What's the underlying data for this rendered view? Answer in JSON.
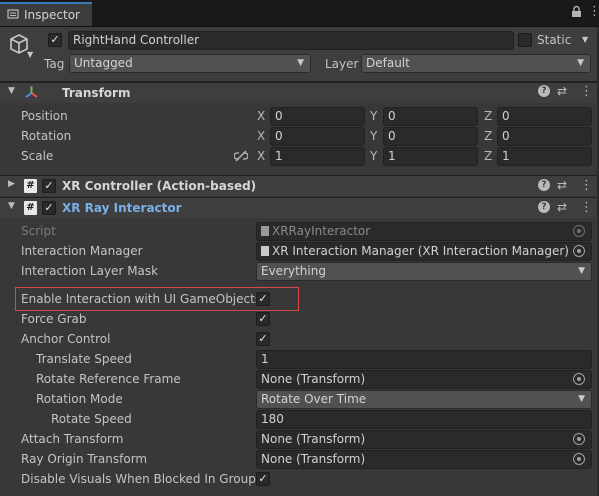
{
  "tab": {
    "label": "Inspector"
  },
  "header": {
    "object_name": "RightHand Controller",
    "static_label": "Static",
    "tag_label": "Tag",
    "tag_value": "Untagged",
    "layer_label": "Layer",
    "layer_value": "Default"
  },
  "transform": {
    "title": "Transform",
    "rows": [
      {
        "label": "Position",
        "x": "0",
        "y": "0",
        "z": "0"
      },
      {
        "label": "Rotation",
        "x": "0",
        "y": "0",
        "z": "0"
      },
      {
        "label": "Scale",
        "x": "1",
        "y": "1",
        "z": "1"
      }
    ],
    "axis": {
      "x": "X",
      "y": "Y",
      "z": "Z"
    }
  },
  "xr_controller": {
    "title": "XR Controller (Action-based)"
  },
  "xr_ray": {
    "title": "XR Ray Interactor",
    "script_label": "Script",
    "script_value": "XRRayInteractor",
    "interaction_manager_label": "Interaction Manager",
    "interaction_manager_value": "XR Interaction Manager (XR Interaction Manager)",
    "interaction_layer_mask_label": "Interaction Layer Mask",
    "interaction_layer_mask_value": "Everything",
    "enable_ui_label": "Enable Interaction with UI GameObjects",
    "force_grab_label": "Force Grab",
    "anchor_control_label": "Anchor Control",
    "translate_speed_label": "Translate Speed",
    "translate_speed_value": "1",
    "rotate_ref_label": "Rotate Reference Frame",
    "rotate_ref_value": "None (Transform)",
    "rotation_mode_label": "Rotation Mode",
    "rotation_mode_value": "Rotate Over Time",
    "rotate_speed_label": "Rotate Speed",
    "rotate_speed_value": "180",
    "attach_transform_label": "Attach Transform",
    "attach_transform_value": "None (Transform)",
    "ray_origin_label": "Ray Origin Transform",
    "ray_origin_value": "None (Transform)",
    "disable_visuals_label": "Disable Visuals When Blocked In Group"
  },
  "icons": {
    "checkmark": "✓",
    "help": "?",
    "settings": "⇄",
    "more": "⋮",
    "lock": "🔒",
    "menu": "⋮",
    "hash": "#",
    "dropdown_arrow": "▼",
    "foldout_open": "▼",
    "foldout_closed": "▶"
  }
}
